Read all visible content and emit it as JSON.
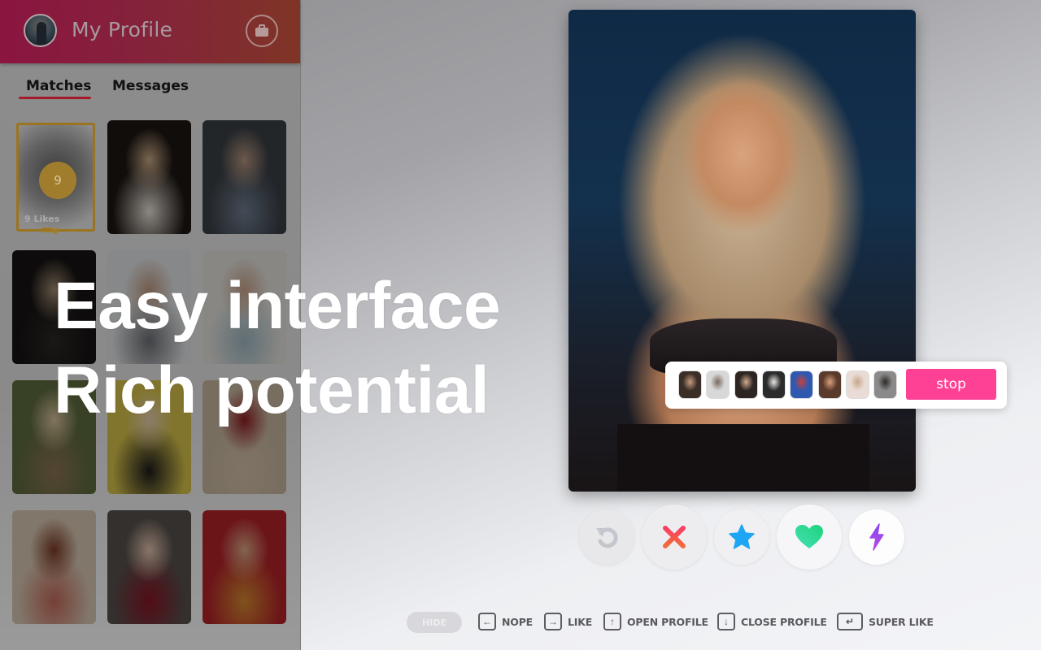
{
  "sidebar": {
    "header": {
      "title": "My Profile",
      "avatar_icon": "user-avatar",
      "action_icon": "briefcase-icon"
    },
    "tabs": [
      {
        "label": "Matches",
        "active": true
      },
      {
        "label": "Messages",
        "active": false
      }
    ],
    "likes_tile": {
      "count": "9",
      "label": "9 Likes",
      "icon": "heart-icon"
    },
    "match_tiles": [
      {
        "description": "blonde woman holding glass of milk",
        "colors": [
          "#1b1512",
          "#caa987",
          "#e8e2d8"
        ]
      },
      {
        "description": "woman in tank top and sunglasses",
        "colors": [
          "#3a3f45",
          "#b49580",
          "#6f7d8f"
        ]
      },
      {
        "description": "blonde woman in black lace",
        "colors": [
          "#151212",
          "#a08b70",
          "#2b2625"
        ]
      },
      {
        "description": "woman in bikini sitting",
        "colors": [
          "#dfe2e4",
          "#c09a80",
          "#6d6f74"
        ]
      },
      {
        "description": "woman kneeling in white top",
        "colors": [
          "#e3e1dc",
          "#caa48a",
          "#9fb8c2"
        ]
      },
      {
        "description": "woman on beach in bikini",
        "colors": [
          "#5e6a3e",
          "#d8c39c",
          "#8c7453"
        ]
      },
      {
        "description": "blonde woman in black t-shirt",
        "colors": [
          "#d7c24a",
          "#e6cfae",
          "#1c1b1c"
        ]
      },
      {
        "description": "woman in red dress on beach",
        "colors": [
          "#c8b8a0",
          "#8f1f24",
          "#d4c0a8"
        ]
      },
      {
        "description": "woman with curly red hair",
        "colors": [
          "#d8c7b3",
          "#7a3a22",
          "#c46a5a"
        ]
      },
      {
        "description": "smiling woman in red sweater",
        "colors": [
          "#55504c",
          "#e6c3ae",
          "#8a1525"
        ]
      },
      {
        "description": "woman resting chin on hand",
        "colors": [
          "#b4232a",
          "#d9a885",
          "#d4892f"
        ]
      }
    ]
  },
  "headline": {
    "line1": "Easy interface",
    "line2": "Rich potential"
  },
  "profile_card": {
    "description": "woman with curly blonde hair and statement necklace"
  },
  "match_strip": {
    "thumbnails": [
      {
        "colors": [
          "#3b2e27",
          "#c79c7f"
        ]
      },
      {
        "colors": [
          "#d8d8d8",
          "#7a6a60"
        ]
      },
      {
        "colors": [
          "#2c2522",
          "#d1ac8e"
        ]
      },
      {
        "colors": [
          "#2c2b2c",
          "#e8e5e0"
        ]
      },
      {
        "colors": [
          "#2f58b0",
          "#c8413a"
        ]
      },
      {
        "colors": [
          "#5a3a2a",
          "#d9a07c"
        ]
      },
      {
        "colors": [
          "#e9dcd6",
          "#c9a688"
        ]
      },
      {
        "colors": [
          "#8a8a8a",
          "#2e2a28"
        ]
      }
    ],
    "stop_label": "stop"
  },
  "actions": [
    {
      "name": "rewind",
      "icon": "rewind-icon",
      "color": "#c3c6cc"
    },
    {
      "name": "nope",
      "icon": "close-icon",
      "color": "#f0475a"
    },
    {
      "name": "super-like",
      "icon": "star-icon",
      "color": "#1ea6f4"
    },
    {
      "name": "like",
      "icon": "heart-icon",
      "color": "#25d48f"
    },
    {
      "name": "boost",
      "icon": "lightning-icon",
      "color": "#9c3ef0"
    }
  ],
  "shortcuts": {
    "hide_label": "HIDE",
    "items": [
      {
        "key_icon": "arrow-left-key-icon",
        "glyph": "←",
        "label": "NOPE"
      },
      {
        "key_icon": "arrow-right-key-icon",
        "glyph": "→",
        "label": "LIKE"
      },
      {
        "key_icon": "arrow-up-key-icon",
        "glyph": "↑",
        "label": "OPEN PROFILE"
      },
      {
        "key_icon": "arrow-down-key-icon",
        "glyph": "↓",
        "label": "CLOSE PROFILE"
      },
      {
        "key_icon": "enter-key-icon",
        "glyph": "↵",
        "label": "SUPER LIKE"
      }
    ]
  },
  "colors": {
    "accent_pink": "#ff4196",
    "tab_underline": "#a4192c",
    "likes_gold": "#a07d2c"
  }
}
